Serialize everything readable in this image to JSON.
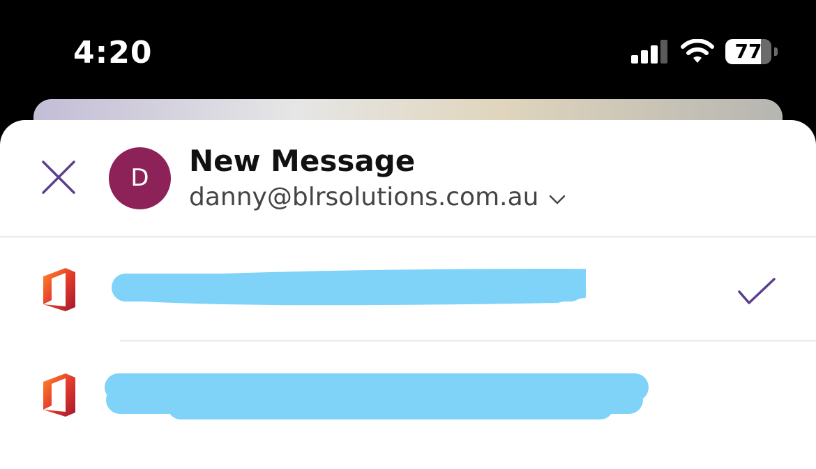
{
  "status_bar": {
    "time": "4:20",
    "battery_level": 77,
    "battery_text": "77",
    "icons": [
      "cellular-signal-icon",
      "wifi-icon",
      "battery-icon"
    ]
  },
  "sheet": {
    "title": "New Message",
    "avatar_initial": "D",
    "avatar_color": "#8c2257",
    "account_email": "danny@blrsolutions.com.au",
    "accent_color": "#5b3f8c"
  },
  "accounts": [
    {
      "name": "",
      "selected": true,
      "icon": "office-icon"
    },
    {
      "name": "",
      "selected": false,
      "icon": "office-icon"
    }
  ],
  "colors": {
    "redaction": "#7fd2f8",
    "divider": "#c8c8c8"
  }
}
